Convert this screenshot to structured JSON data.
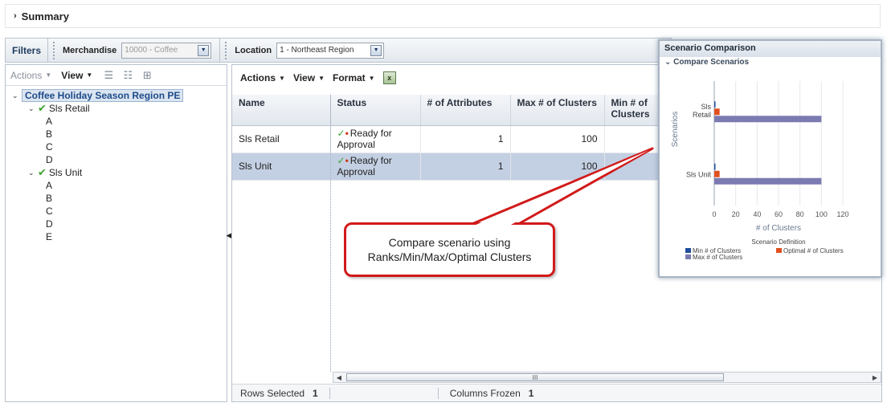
{
  "summary": {
    "label": "Summary"
  },
  "filters": {
    "label": "Filters",
    "merchandise_label": "Merchandise",
    "merchandise_value": "10000 - Coffee",
    "location_label": "Location",
    "location_value": "1 - Northeast Region"
  },
  "left_panel": {
    "toolbar": {
      "actions": "Actions",
      "view": "View"
    },
    "tree": {
      "root": "Coffee Holiday Season Region PE",
      "nodes": [
        {
          "label": "Sls Retail",
          "children": [
            "A",
            "B",
            "C",
            "D"
          ]
        },
        {
          "label": "Sls Unit",
          "children": [
            "A",
            "B",
            "C",
            "D",
            "E"
          ]
        }
      ]
    }
  },
  "main_panel": {
    "toolbar": {
      "actions": "Actions",
      "view": "View",
      "format": "Format"
    },
    "columns": [
      "Name",
      "Status",
      "# of Attributes",
      "Max # of Clusters",
      "Min # of Clusters"
    ],
    "rows": [
      {
        "name": "Sls Retail",
        "status": "Ready for Approval",
        "attributes": "1",
        "max_clusters": "100",
        "min_clusters": ""
      },
      {
        "name": "Sls Unit",
        "status": "Ready for Approval",
        "attributes": "1",
        "max_clusters": "100",
        "min_clusters": ""
      }
    ],
    "selected_row": 1,
    "status_bar": {
      "rows_selected_label": "Rows Selected",
      "rows_selected_value": "1",
      "columns_frozen_label": "Columns Frozen",
      "columns_frozen_value": "1"
    }
  },
  "callout": {
    "line1": "Compare scenario using",
    "line2": "Ranks/Min/Max/Optimal Clusters"
  },
  "scenario_panel": {
    "title": "Scenario Comparison",
    "subtitle": "Compare Scenarios"
  },
  "chart_data": {
    "type": "bar",
    "orientation": "horizontal",
    "categories": [
      "Sls Retail",
      "Sls Unit"
    ],
    "series": [
      {
        "name": "Min # of Clusters",
        "color": "#1f4e9c",
        "values": [
          1,
          1
        ]
      },
      {
        "name": "Optimal # of Clusters",
        "color": "#e0501e",
        "values": [
          5,
          5
        ]
      },
      {
        "name": "Max # of Clusters",
        "color": "#7b7bb2",
        "values": [
          100,
          100
        ]
      }
    ],
    "xlabel": "# of Clusters",
    "ylabel": "Scenarios",
    "xlim": [
      0,
      120
    ],
    "xticks": [
      0,
      20,
      40,
      60,
      80,
      100,
      120
    ],
    "legend_title": "Scenario Definition",
    "legend_position": "bottom",
    "grid": true
  }
}
